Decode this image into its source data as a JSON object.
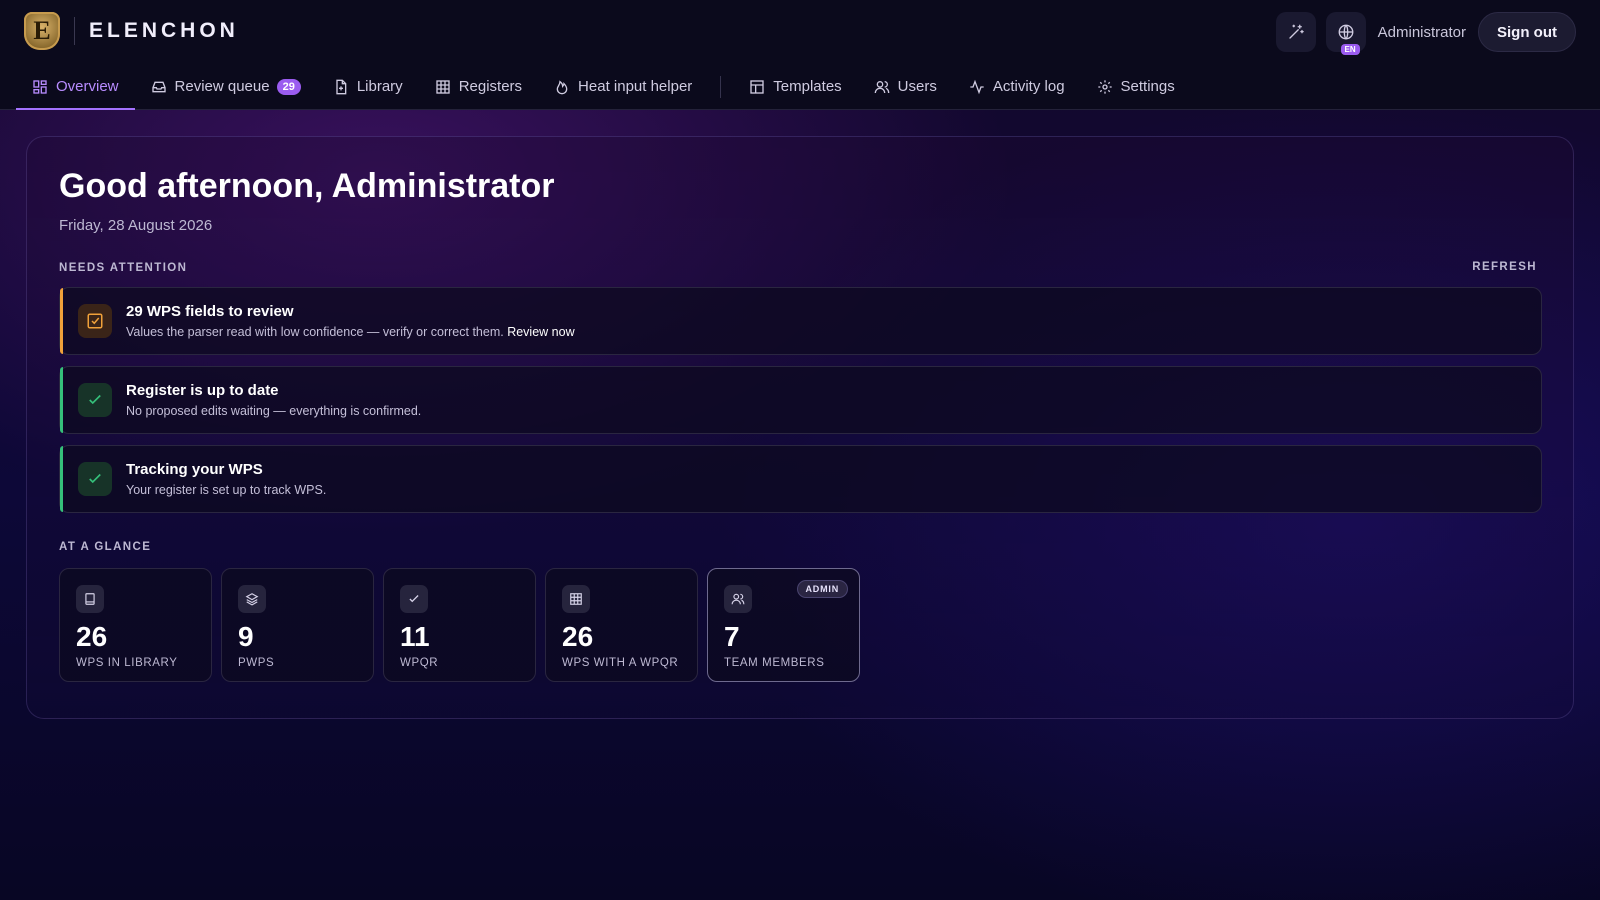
{
  "app": {
    "brand_letter": "E",
    "brand_name": "ELENCHON"
  },
  "topbar": {
    "user_name": "Administrator",
    "sign_out_label": "Sign out",
    "language_badge": "EN",
    "icons": [
      "magic-wand-icon",
      "globe-icon"
    ]
  },
  "nav": {
    "items": [
      {
        "label": "Overview",
        "icon": "grid-icon",
        "active": true
      },
      {
        "label": "Review queue",
        "icon": "inbox-icon",
        "badge": "29"
      },
      {
        "label": "Library",
        "icon": "file-icon"
      },
      {
        "label": "Registers",
        "icon": "table-icon"
      },
      {
        "label": "Heat input helper",
        "icon": "flame-icon"
      },
      {
        "label": "Templates",
        "icon": "layout-icon"
      },
      {
        "label": "Users",
        "icon": "users-icon"
      },
      {
        "label": "Activity log",
        "icon": "activity-icon"
      },
      {
        "label": "Settings",
        "icon": "gear-icon"
      }
    ]
  },
  "main": {
    "greeting": "Good afternoon, Administrator",
    "date": "Friday, 28 August 2026",
    "needs_attention_label": "NEEDS ATTENTION",
    "refresh_label": "REFRESH",
    "alerts": [
      {
        "title": "29 WPS fields to review",
        "description": "Values the parser read with low confidence — verify or correct them.",
        "link": "Review now",
        "status": "warning",
        "icon": "checkbox-icon",
        "accent": "#f0a13a"
      },
      {
        "title": "Register is up to date",
        "description": "No proposed edits waiting — everything is confirmed.",
        "status": "ok",
        "icon": "check-icon",
        "accent": "#35c07a"
      },
      {
        "title": "Tracking your WPS",
        "description": "Your register is set up to track WPS.",
        "status": "ok",
        "icon": "check-icon",
        "accent": "#35c07a"
      }
    ],
    "at_a_glance_label": "AT A GLANCE",
    "stats": [
      {
        "value": "26",
        "label": "WPS IN LIBRARY",
        "icon": "book-icon"
      },
      {
        "value": "9",
        "label": "PWPS",
        "icon": "layers-icon"
      },
      {
        "value": "11",
        "label": "WPQR",
        "icon": "check-icon"
      },
      {
        "value": "26",
        "label": "WPS WITH A WPQR",
        "icon": "table-icon"
      },
      {
        "value": "7",
        "label": "TEAM MEMBERS",
        "icon": "users-icon",
        "tag": "ADMIN"
      }
    ]
  },
  "colors": {
    "accent": "#a472ff",
    "badge": "#9b5cf0",
    "warning": "#f0a13a",
    "success": "#35c07a",
    "topbar_bg": "#0b0a1c"
  }
}
